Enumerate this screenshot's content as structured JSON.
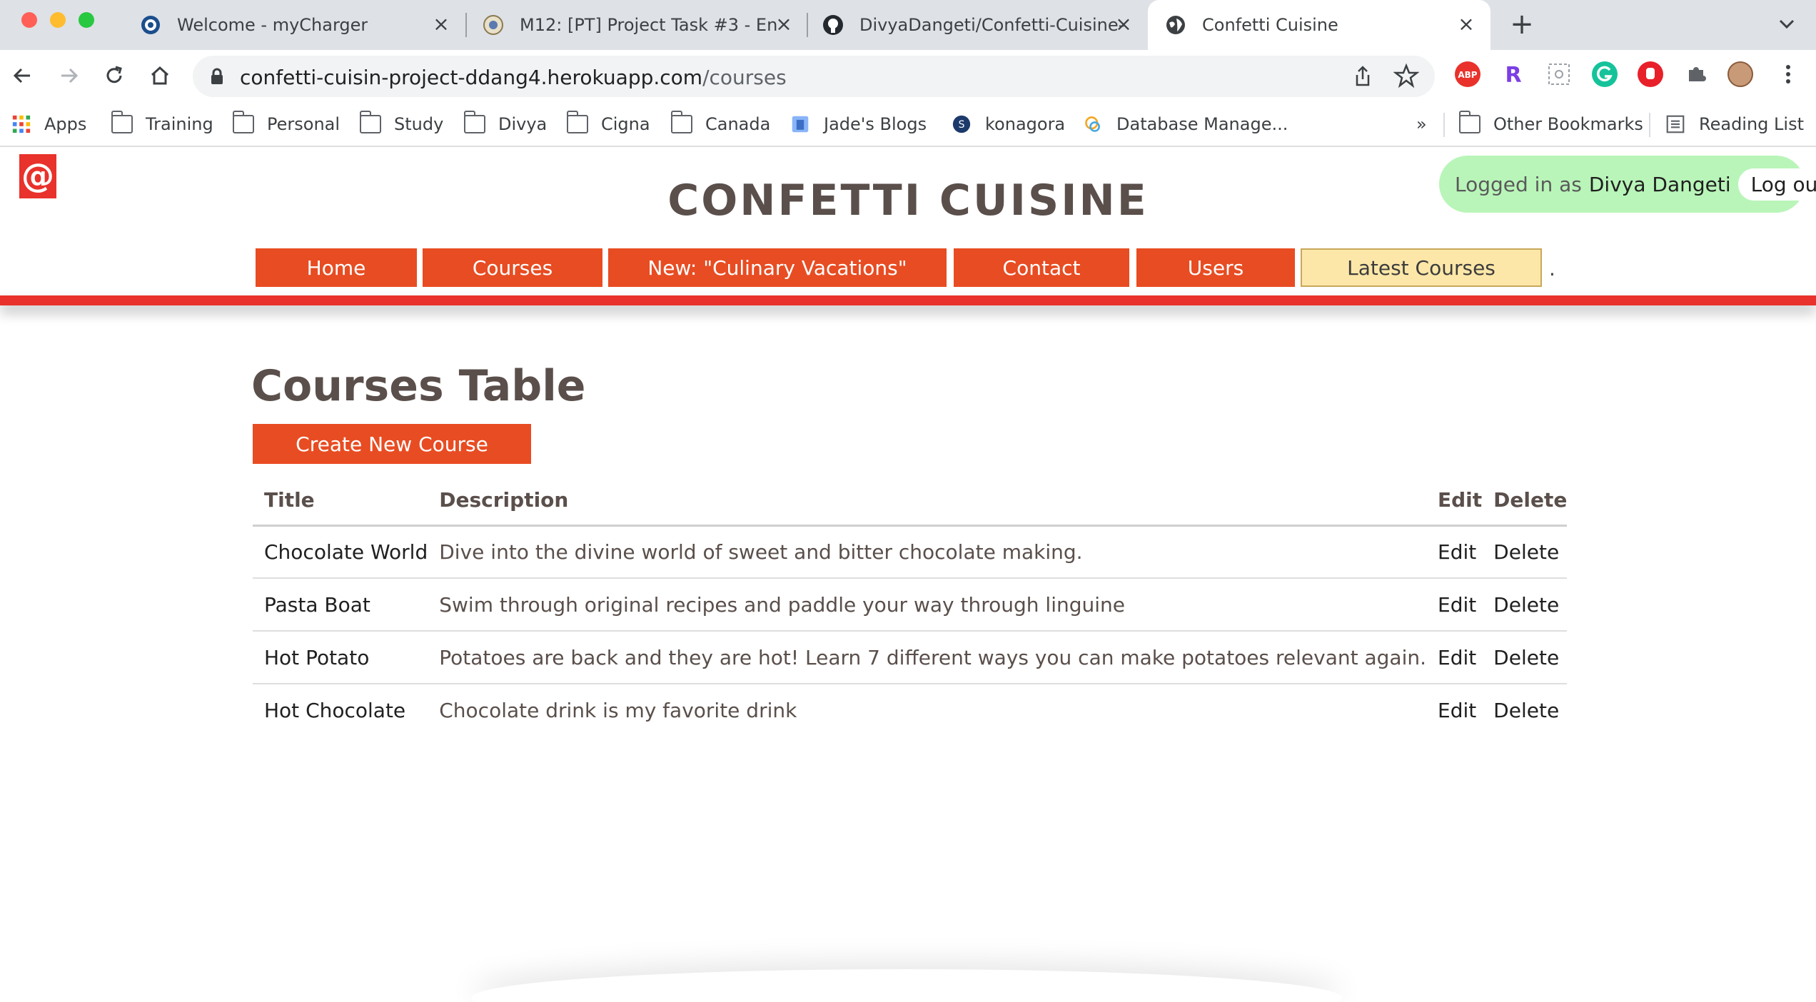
{
  "browser": {
    "tabs": [
      {
        "title": "Welcome - myCharger",
        "favicon": "mycharger-icon"
      },
      {
        "title": "M12: [PT] Project Task #3 - En",
        "favicon": "canvas-seal-icon"
      },
      {
        "title": "DivyaDangeti/Confetti-Cuisine-",
        "favicon": "github-icon"
      },
      {
        "title": "Confetti Cuisine",
        "favicon": "globe-icon",
        "active": true
      }
    ],
    "address": {
      "host": "confetti-cuisin-project-ddang4.herokuapp.com",
      "path": "/courses"
    },
    "bookmarks": [
      {
        "label": "Apps",
        "icon": "apps-grid-icon"
      },
      {
        "label": "Training",
        "icon": "folder-icon"
      },
      {
        "label": "Personal",
        "icon": "folder-icon"
      },
      {
        "label": "Study",
        "icon": "folder-icon"
      },
      {
        "label": "Divya",
        "icon": "folder-icon"
      },
      {
        "label": "Cigna",
        "icon": "folder-icon"
      },
      {
        "label": "Canada",
        "icon": "folder-icon"
      },
      {
        "label": "Jade's Blogs",
        "icon": "blog-icon"
      },
      {
        "label": "konagora",
        "icon": "konagora-icon"
      },
      {
        "label": "Database Manage...",
        "icon": "database-icon"
      }
    ],
    "overflow_label": "»",
    "other_bookmarks": "Other Bookmarks",
    "reading_list": "Reading List"
  },
  "site": {
    "logo_text": "@",
    "title": "CONFETTI CUISINE",
    "login": {
      "prefix": "Logged in as",
      "user": "Divya Dangeti",
      "logout": "Log out"
    },
    "nav": [
      {
        "label": "Home"
      },
      {
        "label": "Courses"
      },
      {
        "label": "New: \"Culinary Vacations\""
      },
      {
        "label": "Contact"
      },
      {
        "label": "Users"
      },
      {
        "label": "Latest Courses"
      }
    ],
    "nav_trailing": "."
  },
  "main": {
    "heading": "Courses Table",
    "create_button": "Create New Course",
    "table": {
      "columns": [
        "Title",
        "Description",
        "Edit",
        "Delete"
      ],
      "rows": [
        {
          "title": "Chocolate World",
          "description": "Dive into the divine world of sweet and bitter chocolate making.",
          "edit": "Edit",
          "delete": "Delete"
        },
        {
          "title": "Pasta Boat",
          "description": "Swim through original recipes and paddle your way through linguine",
          "edit": "Edit",
          "delete": "Delete"
        },
        {
          "title": "Hot Potato",
          "description": "Potatoes are back and they are hot! Learn 7 different ways you can make potatoes relevant again.",
          "edit": "Edit",
          "delete": "Delete"
        },
        {
          "title": "Hot Chocolate",
          "description": "Chocolate drink is my favorite drink",
          "edit": "Edit",
          "delete": "Delete"
        }
      ]
    }
  },
  "colors": {
    "brand_red": "#e84c22",
    "accent_bar": "#e8322b",
    "title_text": "#5a4f4b",
    "login_bg": "#b9f5b9",
    "latest_bg": "#fde7a8"
  }
}
